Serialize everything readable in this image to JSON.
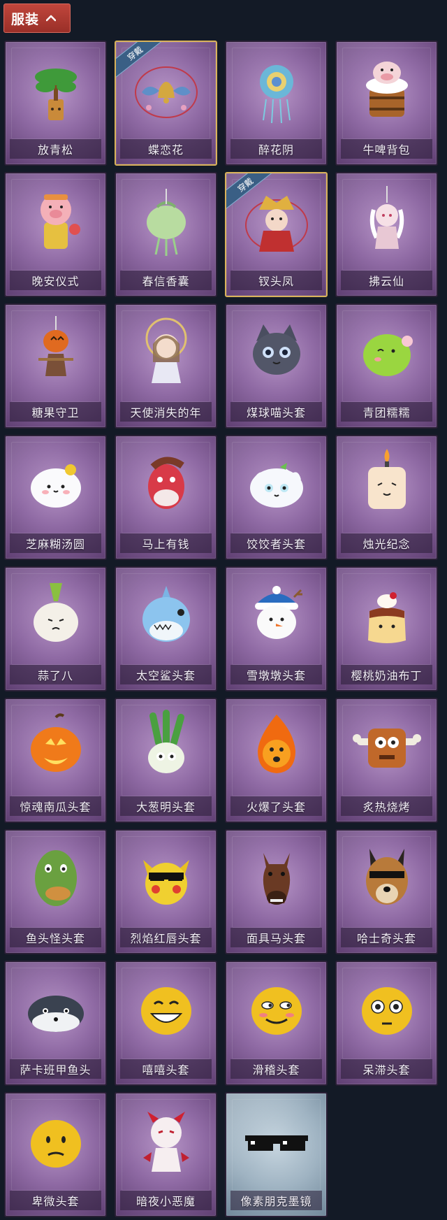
{
  "section": {
    "label": "服装",
    "expanded": true
  },
  "badge_text": "穿戴",
  "items": [
    {
      "name": "放青松",
      "icon": "pine-bonsai-icon",
      "equipped": false,
      "style": "purple"
    },
    {
      "name": "蝶恋花",
      "icon": "butterfly-bell-icon",
      "equipped": true,
      "style": "purple"
    },
    {
      "name": "醉花阴",
      "icon": "flower-ornament-icon",
      "equipped": false,
      "style": "purple"
    },
    {
      "name": "牛啤背包",
      "icon": "cow-beer-backpack-icon",
      "equipped": false,
      "style": "purple"
    },
    {
      "name": "晚安仪式",
      "icon": "pig-doll-icon",
      "equipped": false,
      "style": "purple"
    },
    {
      "name": "春信香囊",
      "icon": "sachet-icon",
      "equipped": false,
      "style": "purple"
    },
    {
      "name": "钗头凤",
      "icon": "phoenix-crown-doll-icon",
      "equipped": true,
      "style": "purple"
    },
    {
      "name": "拂云仙",
      "icon": "cloud-fairy-charm-icon",
      "equipped": false,
      "style": "purple"
    },
    {
      "name": "糖果守卫",
      "icon": "pumpkin-scarecrow-icon",
      "equipped": false,
      "style": "purple"
    },
    {
      "name": "天使消失的年",
      "icon": "angel-girl-icon",
      "equipped": false,
      "style": "purple"
    },
    {
      "name": "煤球喵头套",
      "icon": "black-cat-head-icon",
      "equipped": false,
      "style": "purple"
    },
    {
      "name": "青团糯糯",
      "icon": "green-rice-ball-icon",
      "equipped": false,
      "style": "purple"
    },
    {
      "name": "芝麻糊汤圆",
      "icon": "tangyuan-icon",
      "equipped": false,
      "style": "purple"
    },
    {
      "name": "马上有钱",
      "icon": "red-horse-head-icon",
      "equipped": false,
      "style": "purple"
    },
    {
      "name": "饺饺者头套",
      "icon": "dumpling-head-icon",
      "equipped": false,
      "style": "purple"
    },
    {
      "name": "烛光纪念",
      "icon": "candle-head-icon",
      "equipped": false,
      "style": "purple"
    },
    {
      "name": "蒜了八",
      "icon": "garlic-head-icon",
      "equipped": false,
      "style": "purple"
    },
    {
      "name": "太空鲨头套",
      "icon": "shark-head-icon",
      "equipped": false,
      "style": "purple"
    },
    {
      "name": "雪墩墩头套",
      "icon": "snowman-head-icon",
      "equipped": false,
      "style": "purple"
    },
    {
      "name": "樱桃奶油布丁",
      "icon": "pudding-head-icon",
      "equipped": false,
      "style": "purple"
    },
    {
      "name": "惊魂南瓜头套",
      "icon": "jack-o-lantern-icon",
      "equipped": false,
      "style": "purple"
    },
    {
      "name": "大葱明头套",
      "icon": "scallion-head-icon",
      "equipped": false,
      "style": "purple"
    },
    {
      "name": "火爆了头套",
      "icon": "fire-head-icon",
      "equipped": false,
      "style": "purple"
    },
    {
      "name": "炙热烧烤",
      "icon": "bbq-meat-head-icon",
      "equipped": false,
      "style": "purple"
    },
    {
      "name": "鱼头怪头套",
      "icon": "fish-mask-icon",
      "equipped": false,
      "style": "purple"
    },
    {
      "name": "烈焰红唇头套",
      "icon": "yellow-mouse-mask-icon",
      "equipped": false,
      "style": "purple"
    },
    {
      "name": "面具马头套",
      "icon": "horse-mask-icon",
      "equipped": false,
      "style": "purple"
    },
    {
      "name": "哈士奇头套",
      "icon": "husky-mask-icon",
      "equipped": false,
      "style": "purple"
    },
    {
      "name": "萨卡班甲鱼头",
      "icon": "sacabambaspis-head-icon",
      "equipped": false,
      "style": "purple"
    },
    {
      "name": "嘻嘻头套",
      "icon": "grin-emoji-head-icon",
      "equipped": false,
      "style": "purple"
    },
    {
      "name": "滑稽头套",
      "icon": "smirk-emoji-head-icon",
      "equipped": false,
      "style": "purple"
    },
    {
      "name": "呆滞头套",
      "icon": "stare-emoji-head-icon",
      "equipped": false,
      "style": "purple"
    },
    {
      "name": "卑微头套",
      "icon": "humble-emoji-head-icon",
      "equipped": false,
      "style": "purple"
    },
    {
      "name": "暗夜小恶魔",
      "icon": "little-devil-icon",
      "equipped": false,
      "style": "purple"
    },
    {
      "name": "像素朋克墨镜",
      "icon": "pixel-sunglasses-icon",
      "equipped": false,
      "style": "blue"
    }
  ],
  "colors": {
    "background": "#131a26",
    "tab": "#b03c33",
    "card": "#8f6aa4",
    "equipped_border": "#d9b25a",
    "badge": "#3a5f85"
  }
}
